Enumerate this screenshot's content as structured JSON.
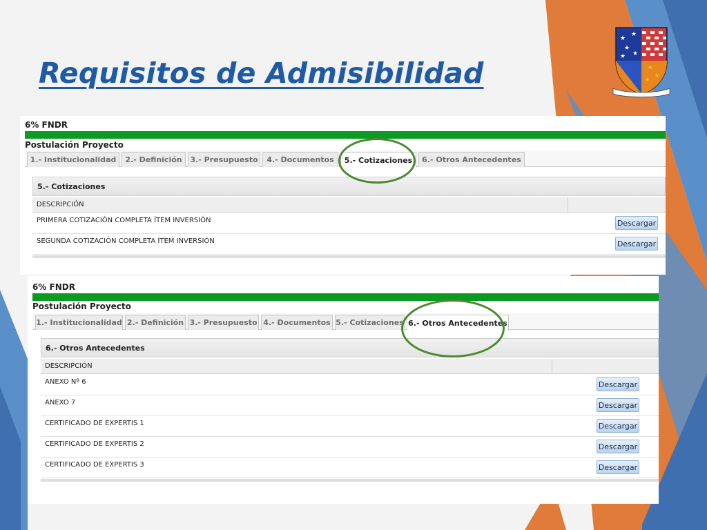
{
  "slide": {
    "title": "Requisitos de Admisibilidad"
  },
  "colors": {
    "title": "#1f5aa6",
    "green_bar": "#0b9b23",
    "highlight_circle": "#4a8a2e",
    "accent_orange": "#e07b39",
    "accent_blue": "#5b8fc9"
  },
  "crest": {
    "icon": "regional-coat-of-arms-icon"
  },
  "screenshot_1": {
    "fndr_label": "6% FNDR",
    "postulacion_label": "Postulación Proyecto",
    "tabs": [
      {
        "label": "1.- Institucionalidad"
      },
      {
        "label": "2.- Definición"
      },
      {
        "label": "3.- Presupuesto"
      },
      {
        "label": "4.- Documentos"
      },
      {
        "label": "5.- Cotizaciones"
      },
      {
        "label": "6.- Otros Antecedentes"
      }
    ],
    "active_tab": "5.- Cotizaciones",
    "panel_title": "5.- Cotizaciones",
    "column_header": "DESCRIPCIÓN",
    "rows": [
      {
        "description": "PRIMERA COTIZACIÓN COMPLETA ÍTEM INVERSIÓN",
        "button": "Descargar"
      },
      {
        "description": "SEGUNDA COTIZACIÓN COMPLETA ÍTEM INVERSIÓN",
        "button": "Descargar"
      }
    ]
  },
  "screenshot_2": {
    "fndr_label": "6% FNDR",
    "postulacion_label": "Postulación Proyecto",
    "tabs": [
      {
        "label": "1.- Institucionalidad"
      },
      {
        "label": "2.- Definición"
      },
      {
        "label": "3.- Presupuesto"
      },
      {
        "label": "4.- Documentos"
      },
      {
        "label": "5.- Cotizaciones"
      },
      {
        "label": "6.- Otros Antecedentes"
      }
    ],
    "active_tab": "6.- Otros Antecedentes",
    "panel_title": "6.- Otros Antecedentes",
    "column_header": "DESCRIPCIÓN",
    "rows": [
      {
        "description": "ANEXO Nº 6",
        "button": "Descargar"
      },
      {
        "description": "ANEXO 7",
        "button": "Descargar"
      },
      {
        "description": "CERTIFICADO DE EXPERTIS 1",
        "button": "Descargar"
      },
      {
        "description": "CERTIFICADO DE EXPERTIS 2",
        "button": "Descargar"
      },
      {
        "description": "CERTIFICADO DE EXPERTIS 3",
        "button": "Descargar"
      }
    ]
  }
}
